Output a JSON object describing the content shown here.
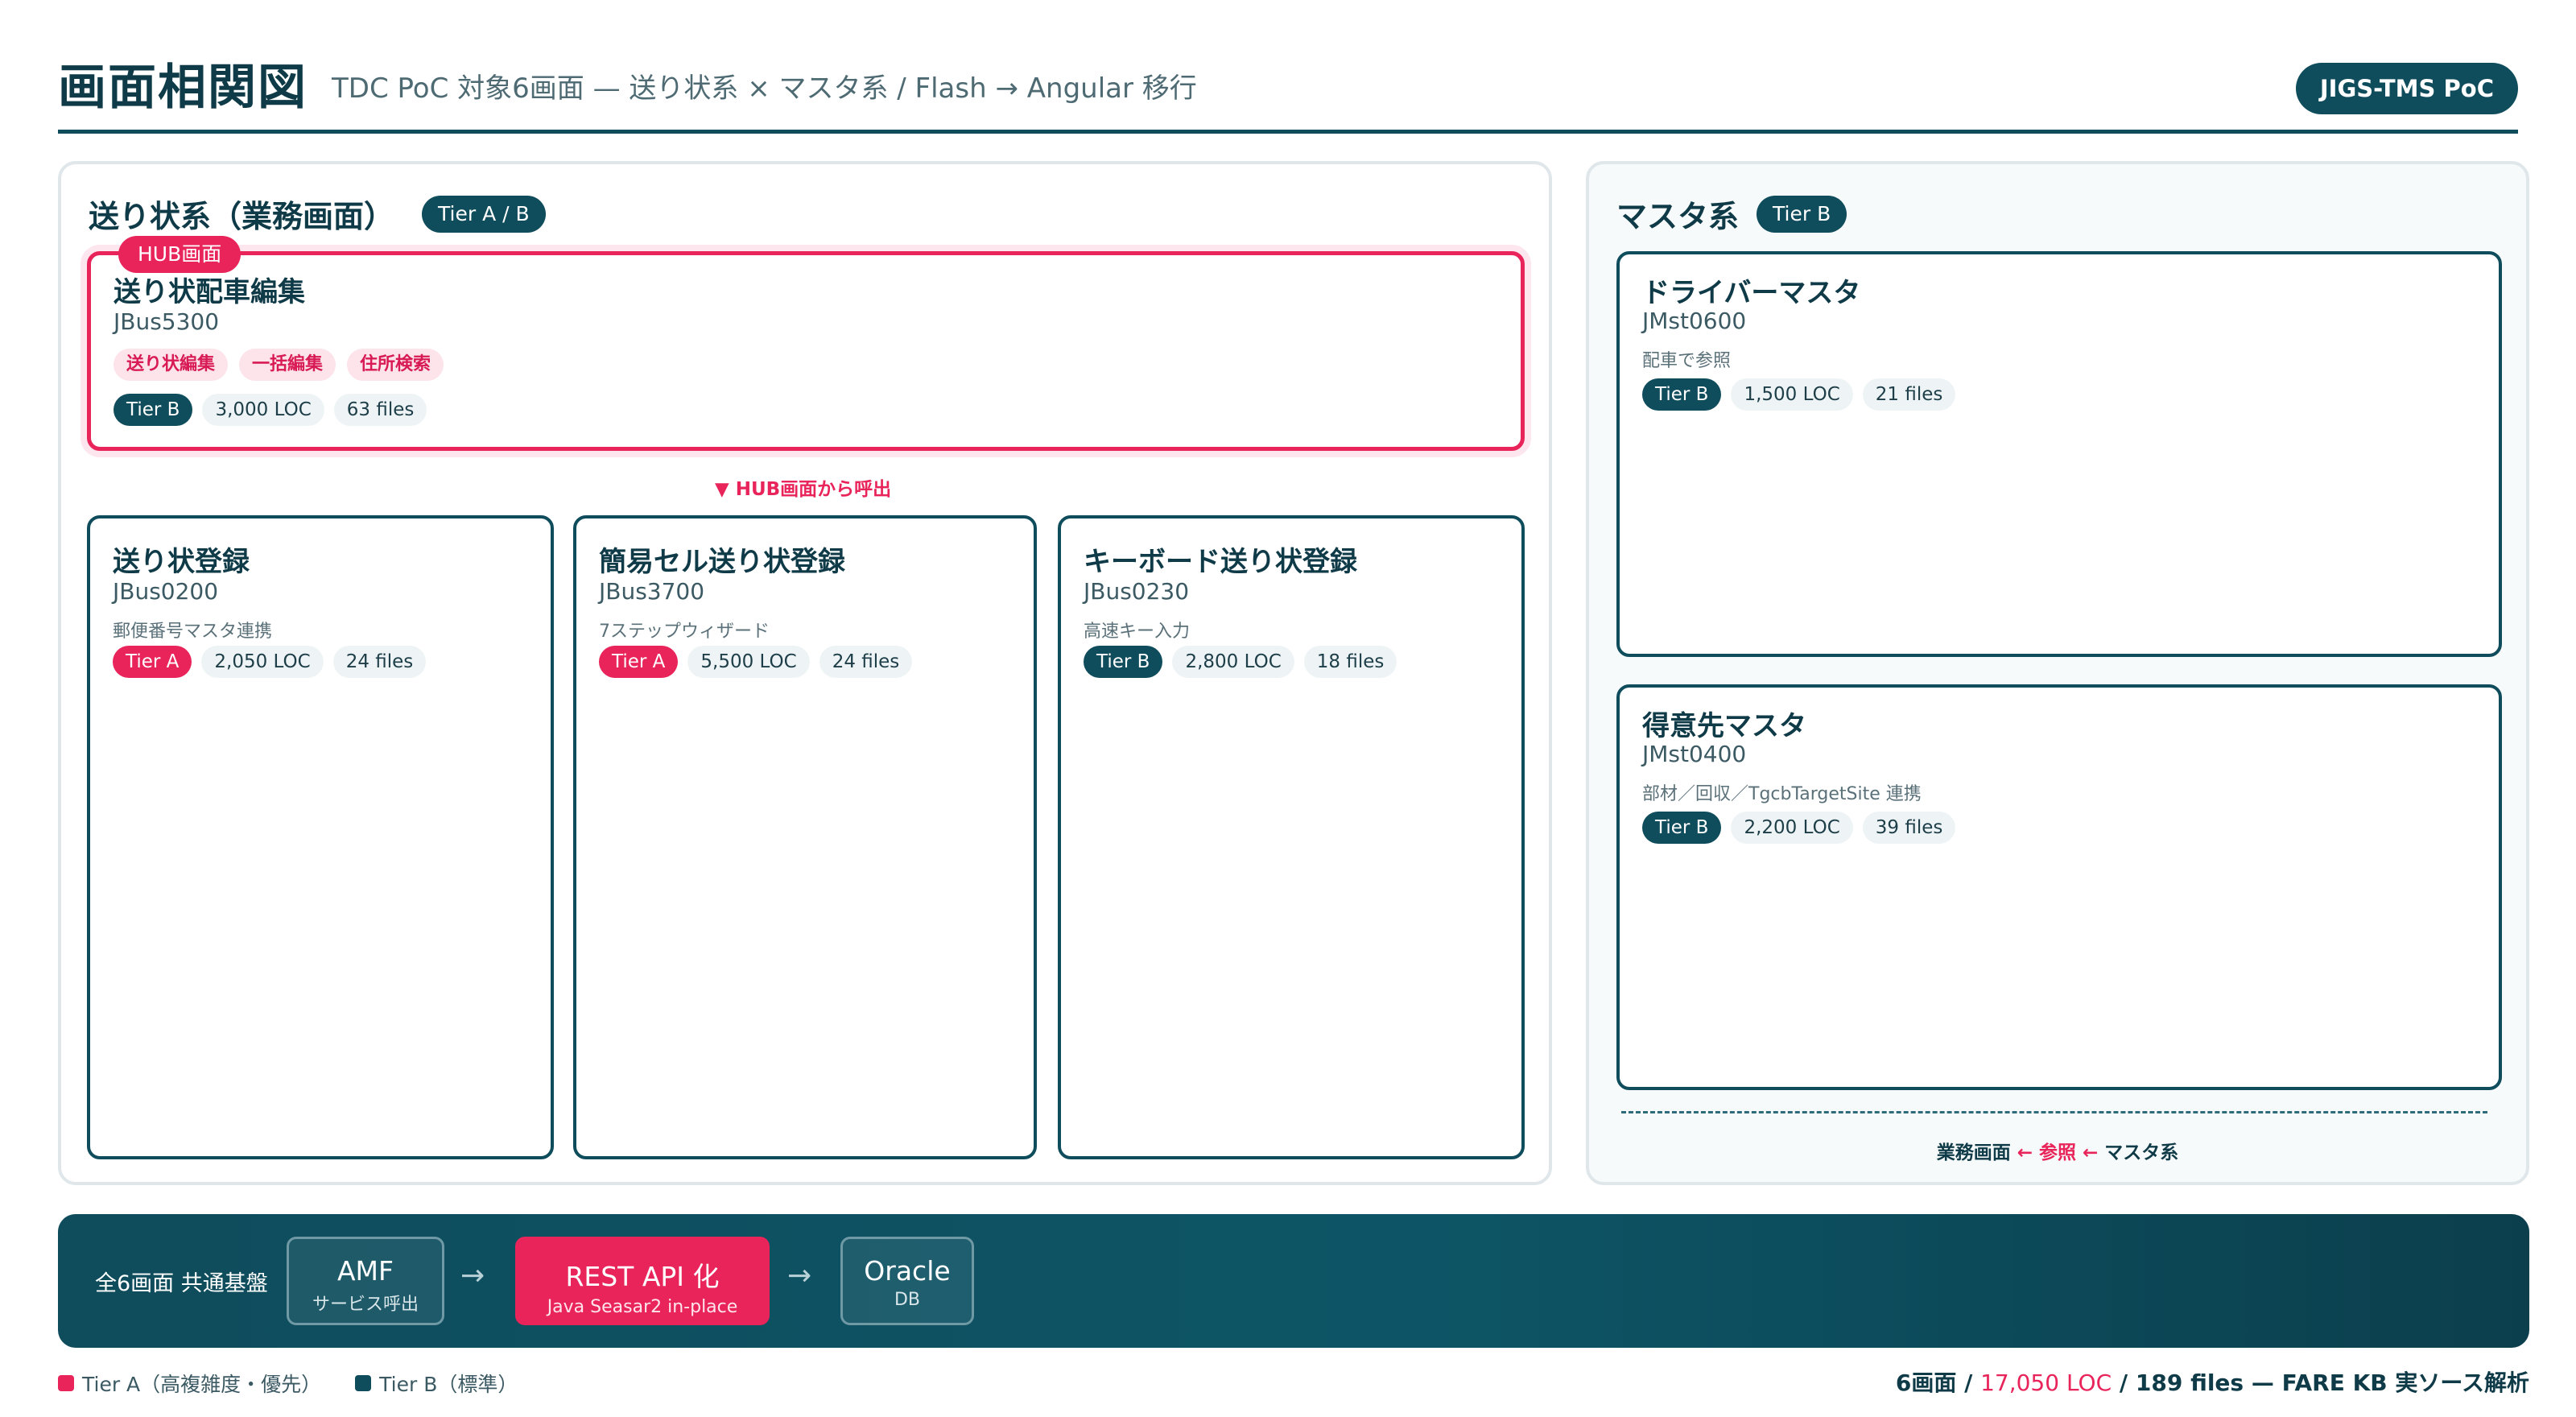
{
  "header": {
    "title": "画面相関図",
    "subtitle": "TDC PoC 対象6画面 — 送り状系 × マスタ系 / Flash → Angular 移行",
    "badge": "JIGS-TMS PoC"
  },
  "left_panel": {
    "title": "送り状系（業務画面）",
    "tier": "Tier A / B",
    "hub_flow_label": "▼ HUB画面から呼出"
  },
  "hub": {
    "label": "HUB画面",
    "name": "送り状配車編集",
    "code": "JBus5300",
    "tags": [
      "送り状編集",
      "一括編集",
      "住所検索"
    ],
    "tier": "Tier B",
    "loc": "3,000 LOC",
    "files": "63 files"
  },
  "screens": [
    {
      "name": "送り状登録",
      "code": "JBus0200",
      "desc": "郵便番号マスタ連携",
      "tier": "Tier A",
      "loc": "2,050 LOC",
      "files": "24 files"
    },
    {
      "name": "簡易セル送り状登録",
      "code": "JBus3700",
      "desc": "7ステップウィザード",
      "tier": "Tier A",
      "loc": "5,500 LOC",
      "files": "24 files"
    },
    {
      "name": "キーボード送り状登録",
      "code": "JBus0230",
      "desc": "高速キー入力",
      "tier": "Tier B",
      "loc": "2,800 LOC",
      "files": "18 files"
    }
  ],
  "right_panel": {
    "title": "マスタ系",
    "tier": "Tier B",
    "ref_left": "業務画面",
    "ref_mid": "← 参照 ←",
    "ref_right": "マスタ系"
  },
  "masters": [
    {
      "name": "ドライバーマスタ",
      "code": "JMst0600",
      "desc": "配車で参照",
      "tier": "Tier B",
      "loc": "1,500 LOC",
      "files": "21 files"
    },
    {
      "name": "得意先マスタ",
      "code": "JMst0400",
      "desc": "部材／回収／TgcbTargetSite 連携",
      "tier": "Tier B",
      "loc": "2,200 LOC",
      "files": "39 files"
    }
  ],
  "foundation": {
    "label": "全6画面 共通基盤",
    "amf_main": "AMF",
    "amf_sub": "サービス呼出",
    "arrow": "→",
    "rest_main": "REST API 化",
    "rest_sub": "Java Seasar2 in-place",
    "db_main": "Oracle",
    "db_sub": "DB"
  },
  "legend": {
    "tier_a": "Tier A（高複雑度・優先）",
    "tier_b": "Tier B（標準）"
  },
  "summary": {
    "prefix": "6画面 /",
    "loc": "17,050 LOC",
    "suffix": "/ 189 files — FARE KB 実ソース解析"
  },
  "colors": {
    "primary": "#0f4c5c",
    "accent": "#e8245a"
  }
}
